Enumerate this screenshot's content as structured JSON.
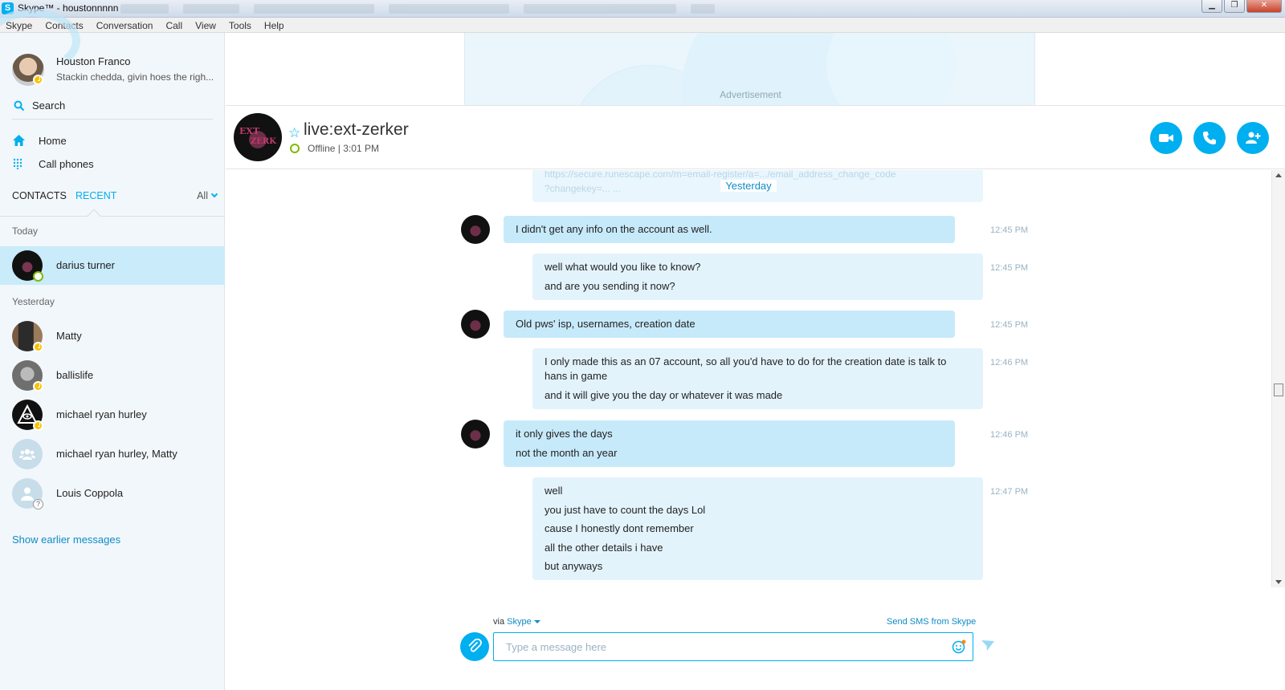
{
  "window": {
    "title": "Skype™ - houstonnnnn",
    "buttons": [
      "minimize",
      "maximize",
      "close"
    ]
  },
  "menu": [
    "Skype",
    "Contacts",
    "Conversation",
    "Call",
    "View",
    "Tools",
    "Help"
  ],
  "profile": {
    "name": "Houston Franco",
    "mood": "Stackin chedda, givin hoes the righ...",
    "status": "away"
  },
  "sidebar": {
    "search_label": "Search",
    "nav": [
      {
        "label": "Home",
        "icon": "home-icon"
      },
      {
        "label": "Call phones",
        "icon": "dialpad-icon"
      }
    ],
    "tabs": {
      "contacts": "CONTACTS",
      "recent": "RECENT",
      "filter": "All"
    },
    "sections": {
      "today": "Today",
      "yesterday": "Yesterday"
    },
    "recent_today": [
      {
        "name": "darius turner",
        "status": "online",
        "active": true
      }
    ],
    "recent_yesterday": [
      {
        "name": "Matty",
        "status": "away"
      },
      {
        "name": "ballislife",
        "status": "away"
      },
      {
        "name": "michael ryan hurley",
        "status": "away"
      },
      {
        "name": "michael ryan hurley, Matty",
        "status": "group"
      },
      {
        "name": "Louis Coppola",
        "status": "unknown"
      }
    ],
    "show_earlier": "Show earlier messages"
  },
  "ad": {
    "label": "Advertisement"
  },
  "conversation": {
    "name": "live:ext-zerker",
    "status": "Offline | 3:01 PM",
    "actions": [
      "video-call",
      "audio-call",
      "add-people"
    ],
    "day_separator": "Yesterday",
    "messages": [
      {
        "dir": "in",
        "time": "12:45 PM",
        "lines": [
          "I didn't get any info on the account as well."
        ]
      },
      {
        "dir": "out",
        "time": "12:45 PM",
        "lines": [
          "well what would you like to know?",
          "and are you sending it now?"
        ]
      },
      {
        "dir": "in",
        "time": "12:45 PM",
        "lines": [
          "Old pws' isp, usernames, creation date"
        ]
      },
      {
        "dir": "out",
        "time": "12:46 PM",
        "lines": [
          "I only made this as an 07 account, so all you'd have to do for the creation date is talk to hans in game",
          "and it will give you the day or whatever it was made"
        ]
      },
      {
        "dir": "in",
        "time": "12:46 PM",
        "lines": [
          "it only gives the days",
          "not the month an year"
        ]
      },
      {
        "dir": "out",
        "time": "12:47 PM",
        "lines": [
          "well",
          "you just have to count the days Lol",
          "cause I honestly dont remember",
          "all the other details i have",
          "but anyways"
        ]
      }
    ]
  },
  "composer": {
    "via_label": "via",
    "via_service": "Skype",
    "send_sms": "Send SMS from Skype",
    "placeholder": "Type a message here"
  },
  "colors": {
    "accent": "#00aff0",
    "bubble_in": "#c7eafb",
    "bubble_out": "#e3f3fc",
    "active_row": "#c9ebfa"
  }
}
